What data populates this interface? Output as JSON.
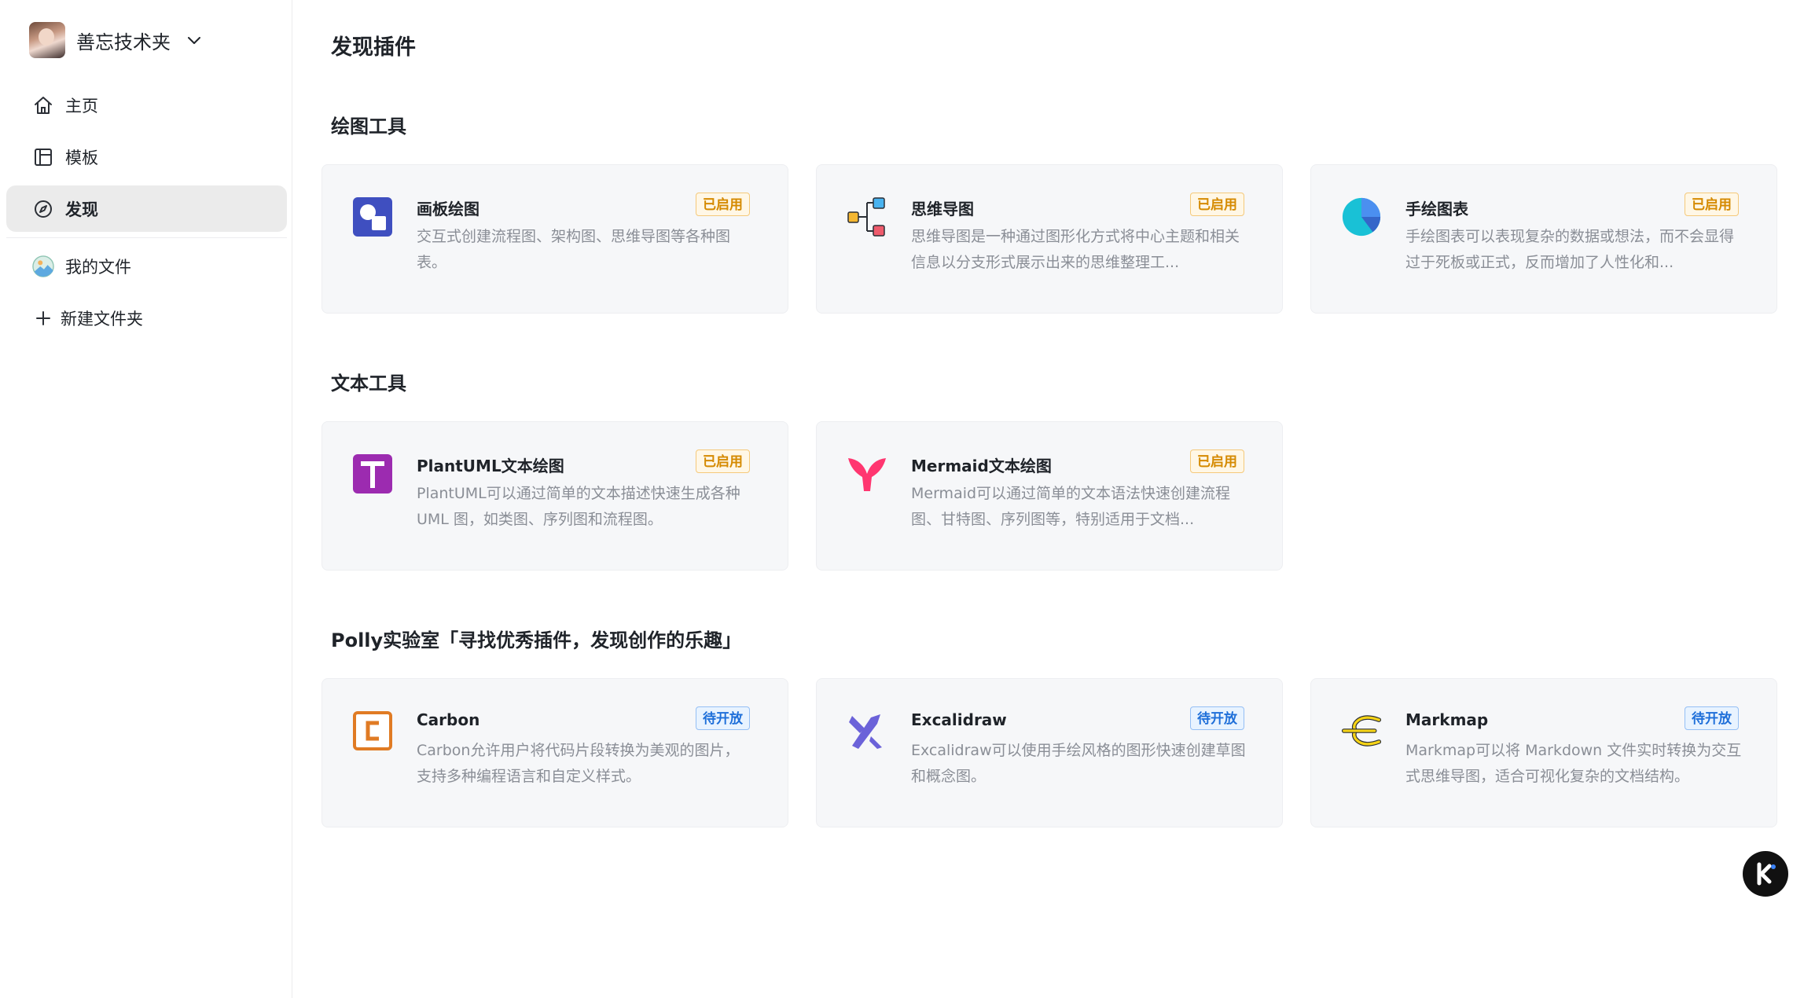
{
  "workspace": {
    "name": "善忘技术夹"
  },
  "nav": {
    "home": "主页",
    "templates": "模板",
    "discover": "发现",
    "my_files": "我的文件",
    "new_folder": "新建文件夹"
  },
  "page": {
    "title": "发现插件"
  },
  "sections": [
    {
      "title": "绘图工具",
      "cards": [
        {
          "title": "画板绘图",
          "badge": "已启用",
          "desc": "交互式创建流程图、架构图、思维导图等各种图表。"
        },
        {
          "title": "思维导图",
          "badge": "已启用",
          "desc": "思维导图是一种通过图形化方式将中心主题和相关信息以分支形式展示出来的思维整理工..."
        },
        {
          "title": "手绘图表",
          "badge": "已启用",
          "desc": "手绘图表可以表现复杂的数据或想法，而不会显得过于死板或正式，反而增加了人性化和..."
        }
      ]
    },
    {
      "title": "文本工具",
      "cards": [
        {
          "title": "PlantUML文本绘图",
          "badge": "已启用",
          "desc": "PlantUML可以通过简单的文本描述快速生成各种 UML 图，如类图、序列图和流程图。"
        },
        {
          "title": "Mermaid文本绘图",
          "badge": "已启用",
          "desc": "Mermaid可以通过简单的文本语法快速创建流程图、甘特图、序列图等，特别适用于文档..."
        }
      ]
    },
    {
      "title": "Polly实验室「寻找优秀插件，发现创作的乐趣」",
      "cards": [
        {
          "title": "Carbon",
          "badge": "待开放",
          "desc": "Carbon允许用户将代码片段转换为美观的图片，支持多种编程语言和自定义样式。"
        },
        {
          "title": "Excalidraw",
          "badge": "待开放",
          "desc": "Excalidraw可以使用手绘风格的图形快速创建草图和概念图。"
        },
        {
          "title": "Markmap",
          "badge": "待开放",
          "desc": "Markmap可以将 Markdown 文件实时转换为交互式思维导图，适合可视化复杂的文档结构。"
        }
      ]
    }
  ],
  "colors": {
    "badge_enabled": "#d58a00",
    "badge_coming_soon": "#1e6fd9",
    "sidebar_active_bg": "#ebebeb",
    "card_bg": "#f6f7f9"
  },
  "icons": {
    "workspace_caret": "chevron-down-icon",
    "home": "home-icon",
    "templates": "template-icon",
    "discover": "compass-icon",
    "my_files": "landscape-icon",
    "new_folder": "plus-icon",
    "help": "k-logo-icon"
  }
}
